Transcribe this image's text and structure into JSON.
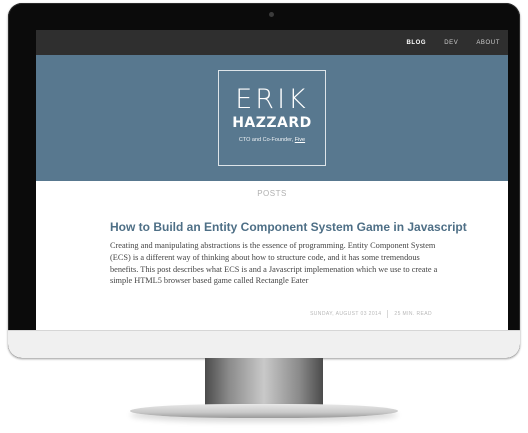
{
  "nav": {
    "items": [
      {
        "label": "BLOG",
        "active": true
      },
      {
        "label": "DEV",
        "active": false
      },
      {
        "label": "ABOUT",
        "active": false
      }
    ]
  },
  "hero": {
    "first_name": "ERIK",
    "last_name": "HAZZARD",
    "tagline_prefix": "CTO and Co-Founder, ",
    "tagline_link": "Five",
    "background_color": "#58788f"
  },
  "posts": {
    "section_label": "POSTS",
    "items": [
      {
        "title": "How to Build an Entity Component System Game in Javascript",
        "excerpt": "Creating and manipulating abstractions is the essence of programming. Entity Component System (ECS) is a different way of thinking about how to structure code, and it has some tremendous benefits. This post describes what ECS is and a Javascript implemenation which we use to create a simple HTML5 browser based game called Rectangle Eater",
        "date": "SUNDAY, AUGUST 03 2014",
        "read_time": "25 MIN. READ"
      }
    ]
  }
}
